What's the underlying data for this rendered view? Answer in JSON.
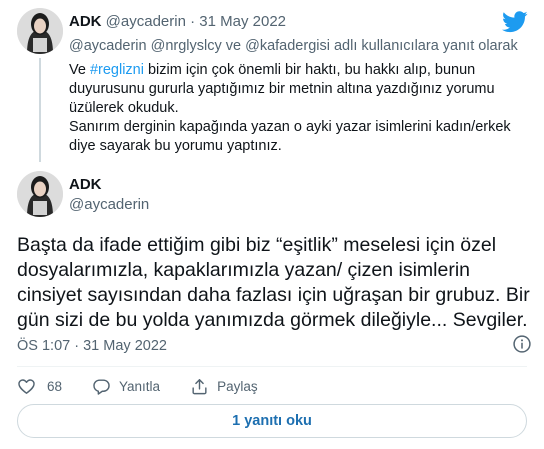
{
  "parent_tweet": {
    "name": "ADK",
    "handle": "@aycaderin",
    "separator": "·",
    "date": "31 May 2022",
    "reply_to": "@aycaderin @nrglyslcy ve @kafadergisi adlı kullanıcılara yanıt olarak",
    "body": {
      "line1_prefix": "Ve ",
      "hashtag": "#reglizni",
      "line1_suffix": " bizim için çok önemli bir haktı, bu hakkı alıp, bunun",
      "line2": "duyurusunu gururla yaptığımız bir metnin altına yazdığınız yorumu",
      "line3": "üzülerek okuduk.",
      "line4": "Sanırım derginin kapağında yazan o ayki yazar isimlerini kadın/erkek",
      "line5": "diye sayarak bu yorumu yaptınız."
    }
  },
  "main_tweet": {
    "name": "ADK",
    "handle": "@aycaderin",
    "body_lines": [
      "Başta da ifade ettiğim gibi biz “eşitlik” meselesi için özel",
      "dosyalarımızla, kapaklarımızla yazan/ çizen isimlerin",
      "cinsiyet sayısından daha fazlası için uğraşan bir grubuz. Bir",
      "gün sizi de bu yolda yanımızda görmek dileğiyle... Sevgiler."
    ],
    "time": "ÖS 1:07",
    "separator": "·",
    "date": "31 May 2022"
  },
  "actions": {
    "like_count": "68",
    "reply_label": "Yanıtla",
    "share_label": "Paylaş"
  },
  "read_replies_label": "1 yanıtı oku",
  "icons": {
    "brand": "twitter-bird-icon",
    "info": "info-icon",
    "like": "heart-icon",
    "reply": "reply-bubble-icon",
    "share": "share-upload-icon"
  },
  "colors": {
    "accent": "#1d9bf0",
    "text": "#0f1419",
    "muted": "#536471",
    "border": "#cfd9de"
  }
}
